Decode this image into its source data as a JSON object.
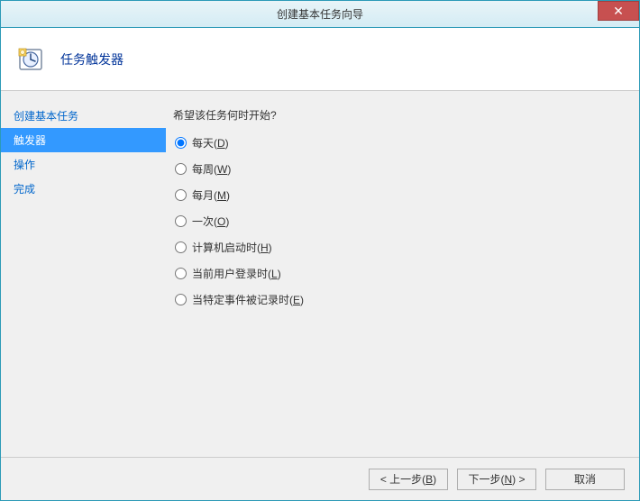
{
  "window": {
    "title": "创建基本任务向导",
    "close_glyph": "✕"
  },
  "header": {
    "title": "任务触发器"
  },
  "sidebar": {
    "items": [
      {
        "label": "创建基本任务",
        "active": false
      },
      {
        "label": "触发器",
        "active": true
      },
      {
        "label": "操作",
        "active": false
      },
      {
        "label": "完成",
        "active": false
      }
    ]
  },
  "content": {
    "prompt": "希望该任务何时开始?",
    "options": [
      {
        "label": "每天",
        "mnemonic": "D",
        "checked": true
      },
      {
        "label": "每周",
        "mnemonic": "W",
        "checked": false
      },
      {
        "label": "每月",
        "mnemonic": "M",
        "checked": false
      },
      {
        "label": "一次",
        "mnemonic": "O",
        "checked": false
      },
      {
        "label": "计算机启动时",
        "mnemonic": "H",
        "checked": false
      },
      {
        "label": "当前用户登录时",
        "mnemonic": "L",
        "checked": false
      },
      {
        "label": "当特定事件被记录时",
        "mnemonic": "E",
        "checked": false
      }
    ]
  },
  "footer": {
    "back": {
      "prefix": "< 上一步(",
      "mnemonic": "B",
      "suffix": ")"
    },
    "next": {
      "prefix": "下一步(",
      "mnemonic": "N",
      "suffix": ") >"
    },
    "cancel": "取消"
  }
}
